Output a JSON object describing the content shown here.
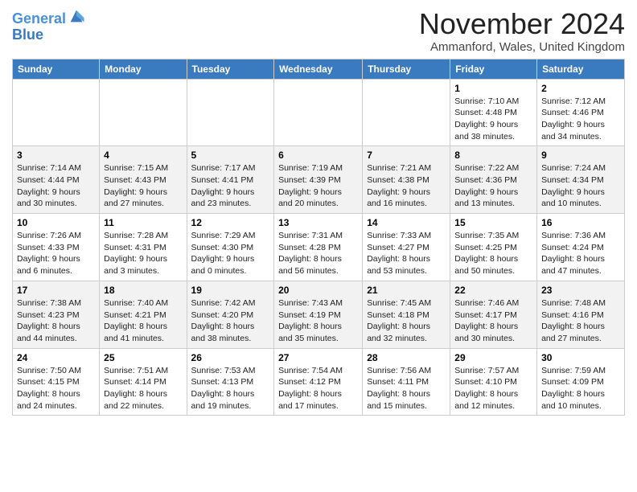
{
  "header": {
    "logo_line1": "General",
    "logo_line2": "Blue",
    "month_title": "November 2024",
    "location": "Ammanford, Wales, United Kingdom"
  },
  "days_of_week": [
    "Sunday",
    "Monday",
    "Tuesday",
    "Wednesday",
    "Thursday",
    "Friday",
    "Saturday"
  ],
  "weeks": [
    [
      {
        "day": "",
        "info": ""
      },
      {
        "day": "",
        "info": ""
      },
      {
        "day": "",
        "info": ""
      },
      {
        "day": "",
        "info": ""
      },
      {
        "day": "",
        "info": ""
      },
      {
        "day": "1",
        "info": "Sunrise: 7:10 AM\nSunset: 4:48 PM\nDaylight: 9 hours\nand 38 minutes."
      },
      {
        "day": "2",
        "info": "Sunrise: 7:12 AM\nSunset: 4:46 PM\nDaylight: 9 hours\nand 34 minutes."
      }
    ],
    [
      {
        "day": "3",
        "info": "Sunrise: 7:14 AM\nSunset: 4:44 PM\nDaylight: 9 hours\nand 30 minutes."
      },
      {
        "day": "4",
        "info": "Sunrise: 7:15 AM\nSunset: 4:43 PM\nDaylight: 9 hours\nand 27 minutes."
      },
      {
        "day": "5",
        "info": "Sunrise: 7:17 AM\nSunset: 4:41 PM\nDaylight: 9 hours\nand 23 minutes."
      },
      {
        "day": "6",
        "info": "Sunrise: 7:19 AM\nSunset: 4:39 PM\nDaylight: 9 hours\nand 20 minutes."
      },
      {
        "day": "7",
        "info": "Sunrise: 7:21 AM\nSunset: 4:38 PM\nDaylight: 9 hours\nand 16 minutes."
      },
      {
        "day": "8",
        "info": "Sunrise: 7:22 AM\nSunset: 4:36 PM\nDaylight: 9 hours\nand 13 minutes."
      },
      {
        "day": "9",
        "info": "Sunrise: 7:24 AM\nSunset: 4:34 PM\nDaylight: 9 hours\nand 10 minutes."
      }
    ],
    [
      {
        "day": "10",
        "info": "Sunrise: 7:26 AM\nSunset: 4:33 PM\nDaylight: 9 hours\nand 6 minutes."
      },
      {
        "day": "11",
        "info": "Sunrise: 7:28 AM\nSunset: 4:31 PM\nDaylight: 9 hours\nand 3 minutes."
      },
      {
        "day": "12",
        "info": "Sunrise: 7:29 AM\nSunset: 4:30 PM\nDaylight: 9 hours\nand 0 minutes."
      },
      {
        "day": "13",
        "info": "Sunrise: 7:31 AM\nSunset: 4:28 PM\nDaylight: 8 hours\nand 56 minutes."
      },
      {
        "day": "14",
        "info": "Sunrise: 7:33 AM\nSunset: 4:27 PM\nDaylight: 8 hours\nand 53 minutes."
      },
      {
        "day": "15",
        "info": "Sunrise: 7:35 AM\nSunset: 4:25 PM\nDaylight: 8 hours\nand 50 minutes."
      },
      {
        "day": "16",
        "info": "Sunrise: 7:36 AM\nSunset: 4:24 PM\nDaylight: 8 hours\nand 47 minutes."
      }
    ],
    [
      {
        "day": "17",
        "info": "Sunrise: 7:38 AM\nSunset: 4:23 PM\nDaylight: 8 hours\nand 44 minutes."
      },
      {
        "day": "18",
        "info": "Sunrise: 7:40 AM\nSunset: 4:21 PM\nDaylight: 8 hours\nand 41 minutes."
      },
      {
        "day": "19",
        "info": "Sunrise: 7:42 AM\nSunset: 4:20 PM\nDaylight: 8 hours\nand 38 minutes."
      },
      {
        "day": "20",
        "info": "Sunrise: 7:43 AM\nSunset: 4:19 PM\nDaylight: 8 hours\nand 35 minutes."
      },
      {
        "day": "21",
        "info": "Sunrise: 7:45 AM\nSunset: 4:18 PM\nDaylight: 8 hours\nand 32 minutes."
      },
      {
        "day": "22",
        "info": "Sunrise: 7:46 AM\nSunset: 4:17 PM\nDaylight: 8 hours\nand 30 minutes."
      },
      {
        "day": "23",
        "info": "Sunrise: 7:48 AM\nSunset: 4:16 PM\nDaylight: 8 hours\nand 27 minutes."
      }
    ],
    [
      {
        "day": "24",
        "info": "Sunrise: 7:50 AM\nSunset: 4:15 PM\nDaylight: 8 hours\nand 24 minutes."
      },
      {
        "day": "25",
        "info": "Sunrise: 7:51 AM\nSunset: 4:14 PM\nDaylight: 8 hours\nand 22 minutes."
      },
      {
        "day": "26",
        "info": "Sunrise: 7:53 AM\nSunset: 4:13 PM\nDaylight: 8 hours\nand 19 minutes."
      },
      {
        "day": "27",
        "info": "Sunrise: 7:54 AM\nSunset: 4:12 PM\nDaylight: 8 hours\nand 17 minutes."
      },
      {
        "day": "28",
        "info": "Sunrise: 7:56 AM\nSunset: 4:11 PM\nDaylight: 8 hours\nand 15 minutes."
      },
      {
        "day": "29",
        "info": "Sunrise: 7:57 AM\nSunset: 4:10 PM\nDaylight: 8 hours\nand 12 minutes."
      },
      {
        "day": "30",
        "info": "Sunrise: 7:59 AM\nSunset: 4:09 PM\nDaylight: 8 hours\nand 10 minutes."
      }
    ]
  ]
}
